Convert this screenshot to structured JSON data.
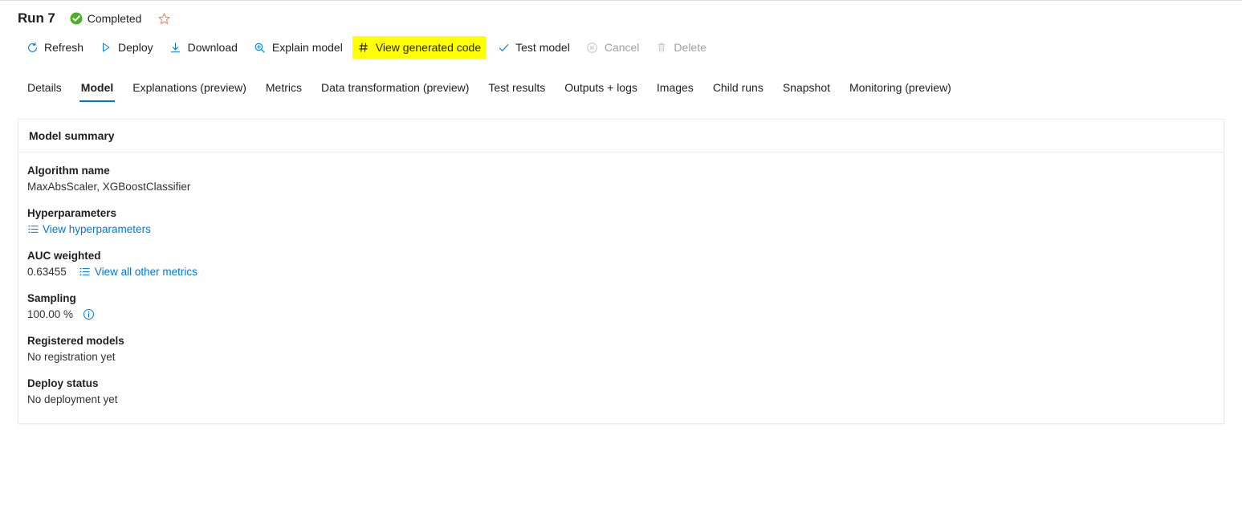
{
  "header": {
    "run_title": "Run 7",
    "status_text": "Completed",
    "status_icon": "check-circle-icon",
    "status_color": "#4caf28",
    "favorite_icon": "star-outline-icon",
    "favorite_color": "#e8836b"
  },
  "toolbar": {
    "items": [
      {
        "label": "Refresh",
        "icon": "refresh-icon",
        "disabled": false,
        "highlighted": false
      },
      {
        "label": "Deploy",
        "icon": "play-triangle-icon",
        "disabled": false,
        "highlighted": false
      },
      {
        "label": "Download",
        "icon": "download-icon",
        "disabled": false,
        "highlighted": false
      },
      {
        "label": "Explain model",
        "icon": "magnifier-icon",
        "disabled": false,
        "highlighted": false
      },
      {
        "label": "View generated code",
        "icon": "hash-icon",
        "disabled": false,
        "highlighted": true
      },
      {
        "label": "Test model",
        "icon": "checkmark-icon",
        "disabled": false,
        "highlighted": false
      },
      {
        "label": "Cancel",
        "icon": "cancel-circle-icon",
        "disabled": true,
        "highlighted": false
      },
      {
        "label": "Delete",
        "icon": "trash-icon",
        "disabled": true,
        "highlighted": false
      }
    ],
    "highlight_color": "#ffff00"
  },
  "tabs": {
    "active_index": 1,
    "accent_color": "#0078d4",
    "items": [
      {
        "label": "Details"
      },
      {
        "label": "Model"
      },
      {
        "label": "Explanations (preview)"
      },
      {
        "label": "Metrics"
      },
      {
        "label": "Data transformation (preview)"
      },
      {
        "label": "Test results"
      },
      {
        "label": "Outputs + logs"
      },
      {
        "label": "Images"
      },
      {
        "label": "Child runs"
      },
      {
        "label": "Snapshot"
      },
      {
        "label": "Monitoring (preview)"
      }
    ]
  },
  "model_summary": {
    "title": "Model summary",
    "algorithm_name": {
      "label": "Algorithm name",
      "value": "MaxAbsScaler, XGBoostClassifier"
    },
    "hyperparameters": {
      "label": "Hyperparameters",
      "link_text": "View hyperparameters",
      "link_icon": "list-icon"
    },
    "auc_weighted": {
      "label": "AUC weighted",
      "value": "0.63455",
      "link_text": "View all other metrics",
      "link_icon": "list-icon"
    },
    "sampling": {
      "label": "Sampling",
      "value": "100.00 %",
      "info_icon": "info-circle-icon"
    },
    "registered_models": {
      "label": "Registered models",
      "value": "No registration yet"
    },
    "deploy_status": {
      "label": "Deploy status",
      "value": "No deployment yet"
    }
  }
}
